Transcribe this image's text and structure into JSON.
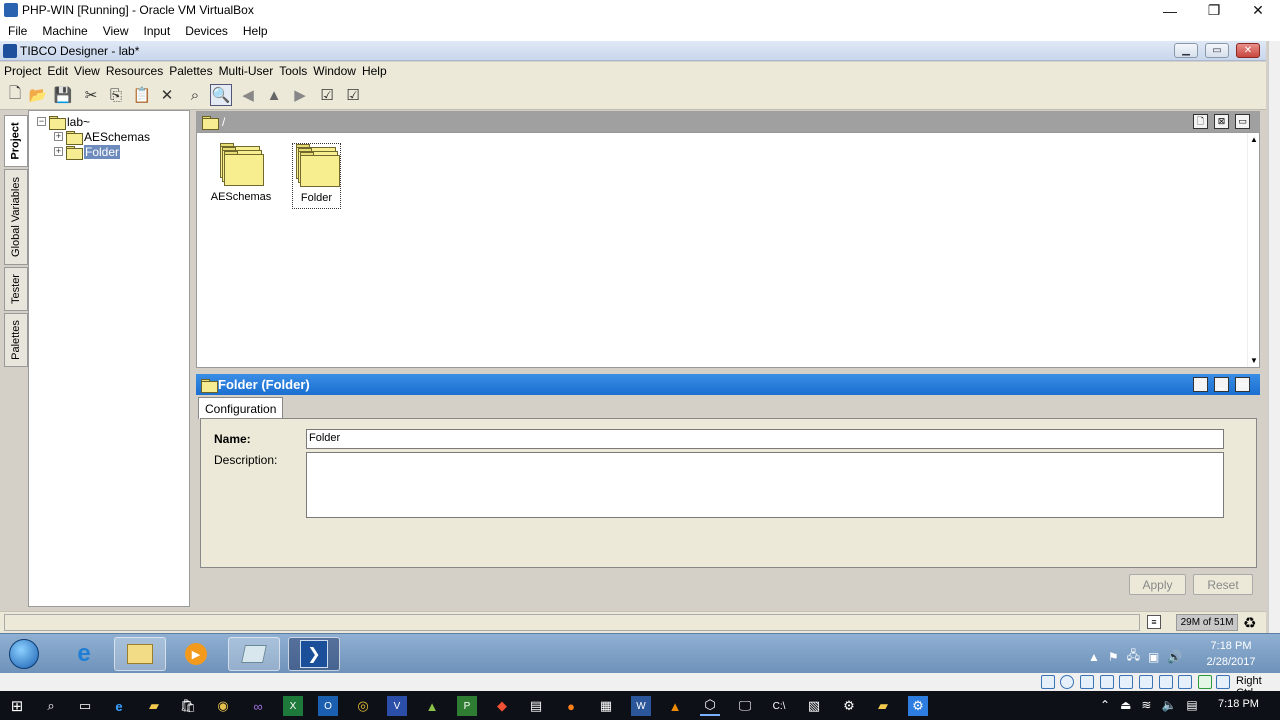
{
  "vbox": {
    "title": "PHP-WIN [Running] - Oracle VM VirtualBox",
    "menu": [
      "File",
      "Machine",
      "View",
      "Input",
      "Devices",
      "Help"
    ],
    "controls": {
      "minimize": "—",
      "restore": "❐",
      "close": "✕"
    },
    "status_host_key": "Right Ctrl"
  },
  "tibco": {
    "title": "TIBCO Designer - lab*",
    "menu": [
      "Project",
      "Edit",
      "View",
      "Resources",
      "Palettes",
      "Multi-User",
      "Tools",
      "Window",
      "Help"
    ],
    "toolbar_icons": [
      "new-project-icon",
      "open-icon",
      "save-icon",
      "cut-icon",
      "copy-icon",
      "paste-icon",
      "delete-icon",
      "find-icon",
      "zoom-icon",
      "back-icon",
      "up-icon",
      "forward-icon",
      "validate-icon",
      "validate-all-icon"
    ]
  },
  "side_tabs": [
    "Project",
    "Global Variables",
    "Tester",
    "Palettes"
  ],
  "tree": {
    "root": "lab~",
    "children": [
      "AESchemas",
      "Folder"
    ],
    "expander_root": "−",
    "expander_child": "+"
  },
  "design": {
    "path": "/",
    "items": [
      "AESchemas",
      "Folder"
    ]
  },
  "properties": {
    "title": "Folder (Folder)",
    "tab": "Configuration",
    "name_label": "Name:",
    "name_value": "Folder",
    "description_label": "Description:",
    "description_value": "",
    "apply": "Apply",
    "reset": "Reset"
  },
  "status": {
    "memory": "29M of 51M"
  },
  "guest_clock": {
    "time": "7:18 PM",
    "date": "2/28/2017"
  },
  "host_clock": {
    "time": "7:18 PM"
  }
}
